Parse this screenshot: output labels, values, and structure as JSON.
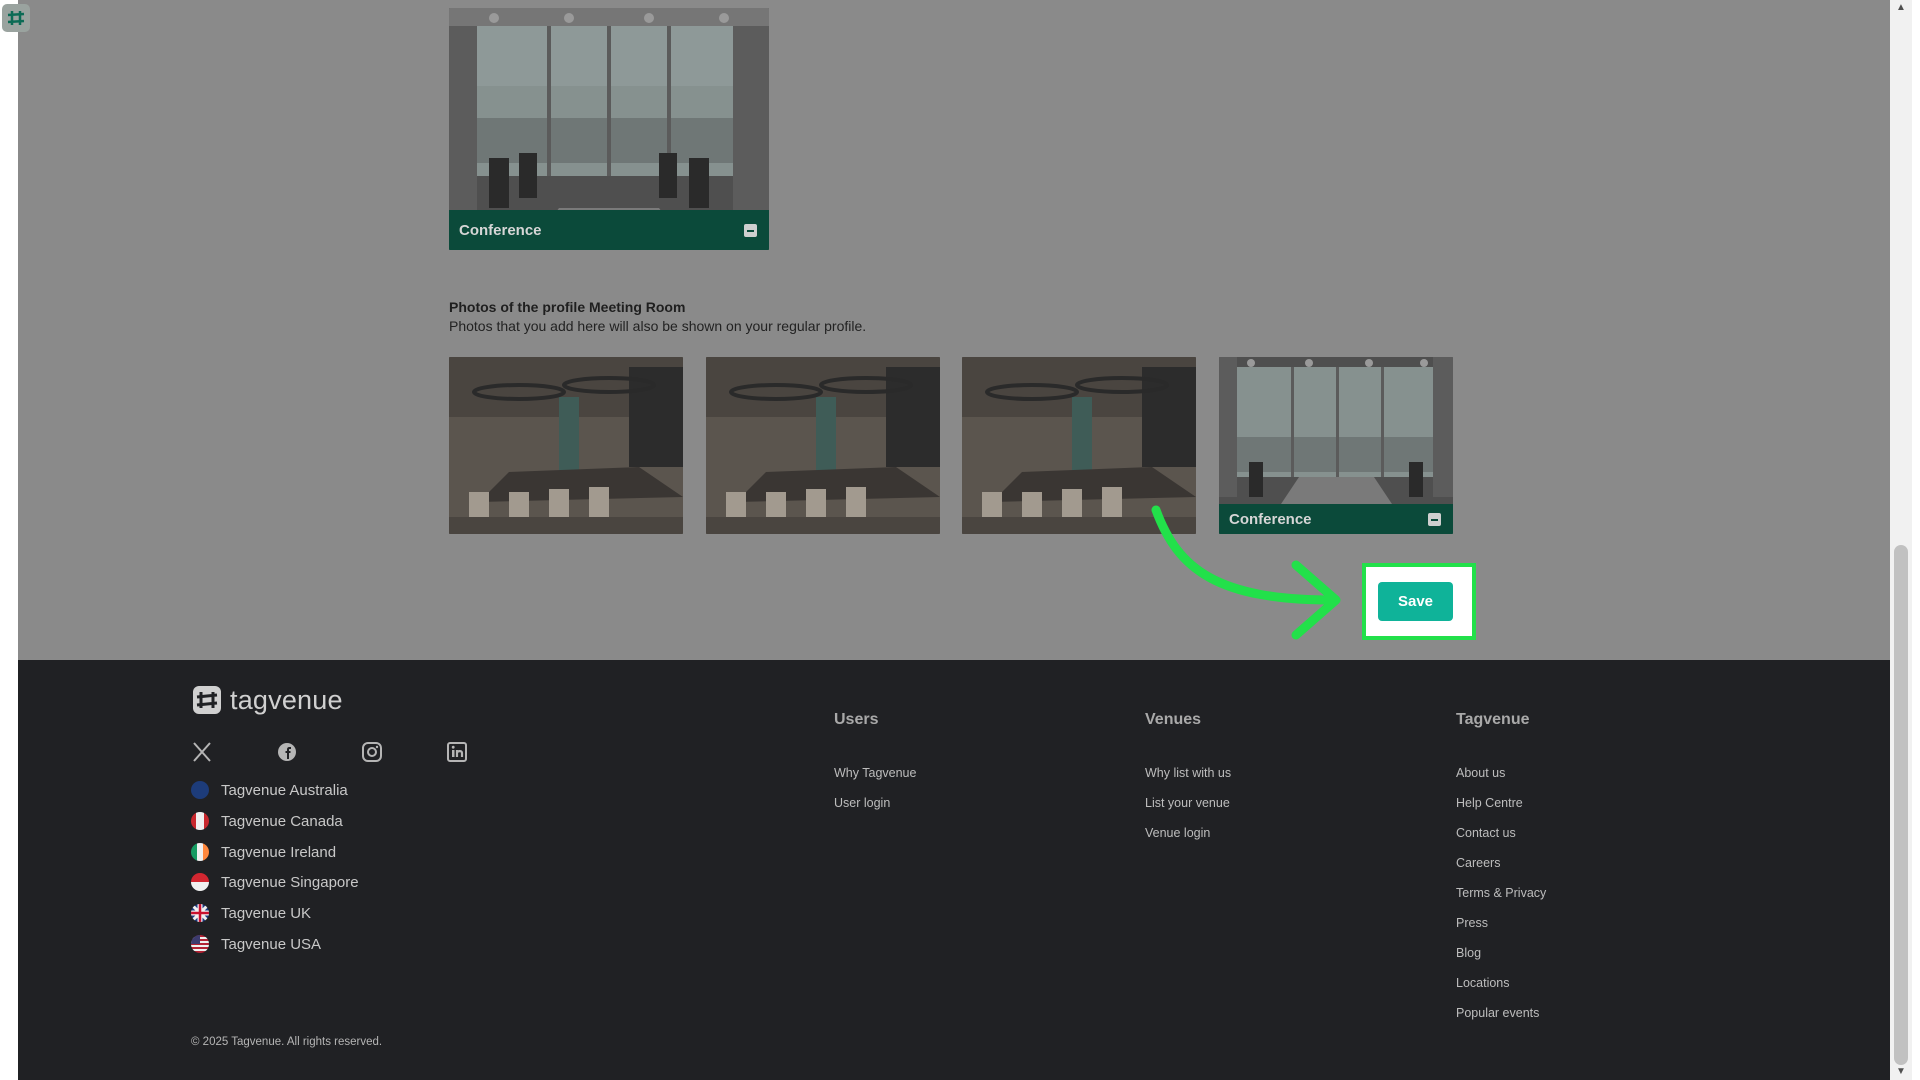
{
  "top_photo": {
    "label": "Conference"
  },
  "section": {
    "title": "Photos of the profile Meeting Room",
    "description": "Photos that you add here will also be shown on your regular profile."
  },
  "gallery": [
    {
      "label": ""
    },
    {
      "label": ""
    },
    {
      "label": ""
    },
    {
      "label": "Conference"
    }
  ],
  "save_label": "Save",
  "footer": {
    "logo": "tagvenue",
    "social": [
      "x-icon",
      "facebook-icon",
      "instagram-icon",
      "linkedin-icon"
    ],
    "countries": [
      {
        "label": "Tagvenue Australia"
      },
      {
        "label": "Tagvenue Canada"
      },
      {
        "label": "Tagvenue Ireland"
      },
      {
        "label": "Tagvenue Singapore"
      },
      {
        "label": "Tagvenue UK"
      },
      {
        "label": "Tagvenue USA"
      }
    ],
    "columns": [
      {
        "title": "Users",
        "links": [
          "Why Tagvenue",
          "User login"
        ]
      },
      {
        "title": "Venues",
        "links": [
          "Why list with us",
          "List your venue",
          "Venue login"
        ]
      },
      {
        "title": "Tagvenue",
        "links": [
          "About us",
          "Help Centre",
          "Contact us",
          "Careers",
          "Terms & Privacy",
          "Press",
          "Blog",
          "Locations",
          "Popular events"
        ]
      }
    ],
    "copyright": "© 2025 Tagvenue. All rights reserved."
  },
  "colors": {
    "accent": "#0fb399",
    "highlight": "#22e04a",
    "label_bar": "#0b4a3a",
    "footer_bg": "#202124"
  }
}
